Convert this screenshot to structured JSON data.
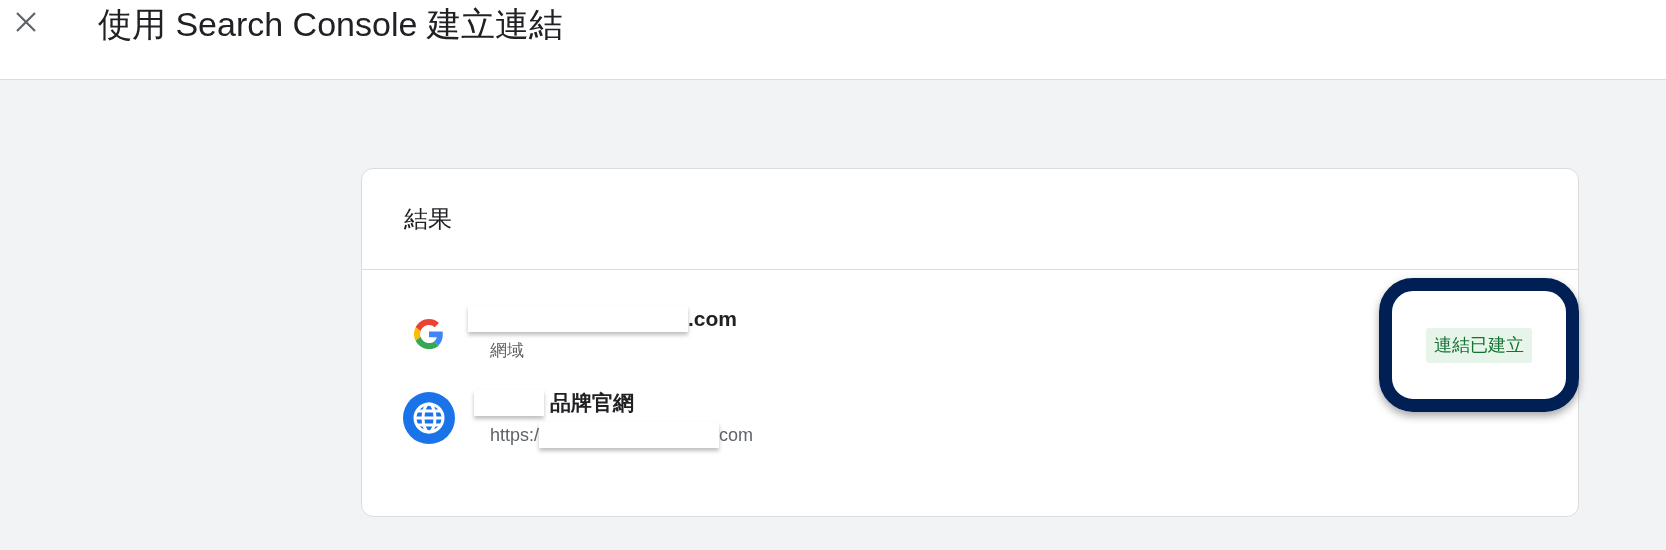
{
  "header": {
    "title": "使用 Search Console 建立連結"
  },
  "card": {
    "title": "結果",
    "properties": [
      {
        "kind": "domain",
        "name": ".com",
        "detail": "網域"
      },
      {
        "kind": "url",
        "name": "品牌官網",
        "detail_parts": [
          "https:/",
          "com"
        ]
      }
    ],
    "status": {
      "label": "連結已建立",
      "highlighted": true
    }
  }
}
